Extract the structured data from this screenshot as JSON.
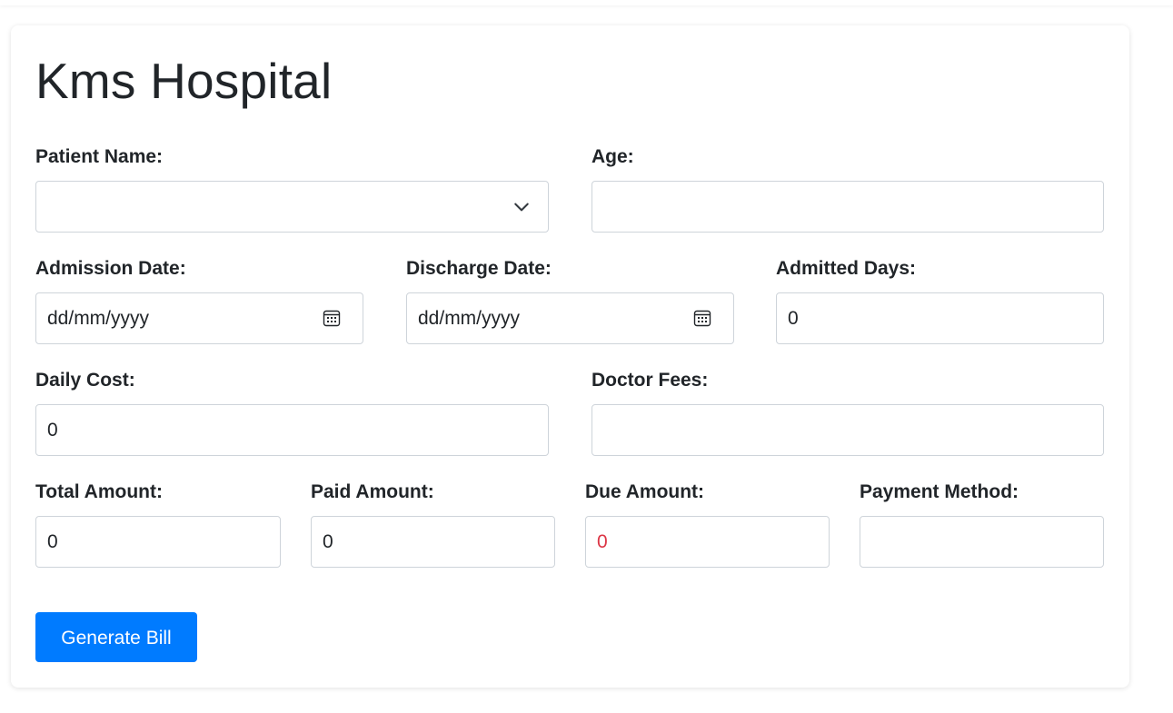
{
  "page": {
    "title": "Kms Hospital"
  },
  "form": {
    "patient_name": {
      "label": "Patient Name:",
      "value": ""
    },
    "age": {
      "label": "Age:",
      "value": ""
    },
    "admission_date": {
      "label": "Admission Date:",
      "placeholder": "dd/mm/yyyy",
      "value": ""
    },
    "discharge_date": {
      "label": "Discharge Date:",
      "placeholder": "dd/mm/yyyy",
      "value": ""
    },
    "admitted_days": {
      "label": "Admitted Days:",
      "value": "0"
    },
    "daily_cost": {
      "label": "Daily Cost:",
      "value": "0"
    },
    "doctor_fees": {
      "label": "Doctor Fees:",
      "value": ""
    },
    "total_amount": {
      "label": "Total Amount:",
      "value": "0"
    },
    "paid_amount": {
      "label": "Paid Amount:",
      "value": "0"
    },
    "due_amount": {
      "label": "Due Amount:",
      "value": "0"
    },
    "payment_method": {
      "label": "Payment Method:",
      "value": ""
    }
  },
  "actions": {
    "generate_bill_label": "Generate Bill"
  },
  "icons": {
    "patient_select": "chevron-down-icon",
    "date_picker": "calendar-icon"
  },
  "colors": {
    "primary": "#007bff",
    "due_text": "#dc3545",
    "border": "#ced4da",
    "text": "#212529"
  }
}
